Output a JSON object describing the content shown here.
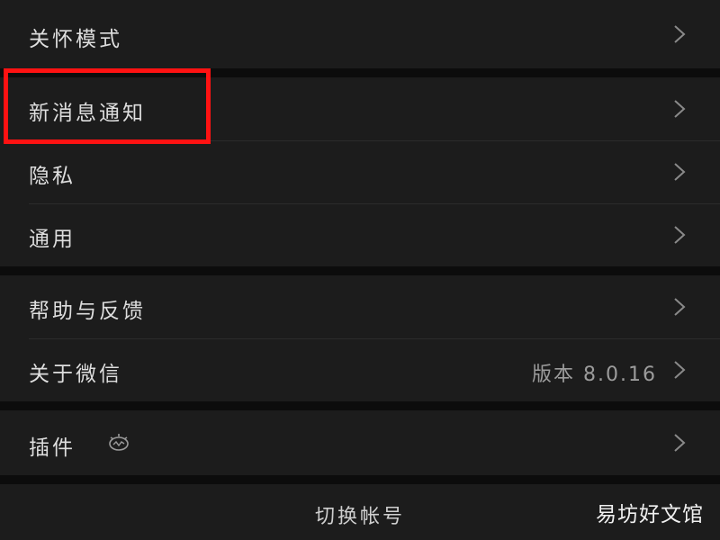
{
  "settings": {
    "groups": [
      {
        "items": [
          {
            "label": "关怀模式"
          }
        ]
      },
      {
        "items": [
          {
            "label": "新消息通知"
          },
          {
            "label": "隐私"
          },
          {
            "label": "通用"
          }
        ]
      },
      {
        "items": [
          {
            "label": "帮助与反馈"
          },
          {
            "label": "关于微信",
            "value": "版本 8.0.16"
          }
        ]
      },
      {
        "items": [
          {
            "label": "插件",
            "icon": "plugin-icon"
          }
        ]
      }
    ]
  },
  "bottom": {
    "switch_account": "切换帐号"
  },
  "watermark": "易坊好文馆",
  "colors": {
    "background": "#0c0c0c",
    "cell": "#1c1c1c",
    "highlight": "#ff1212"
  },
  "icons": {
    "chevron": "chevron-right-icon"
  }
}
